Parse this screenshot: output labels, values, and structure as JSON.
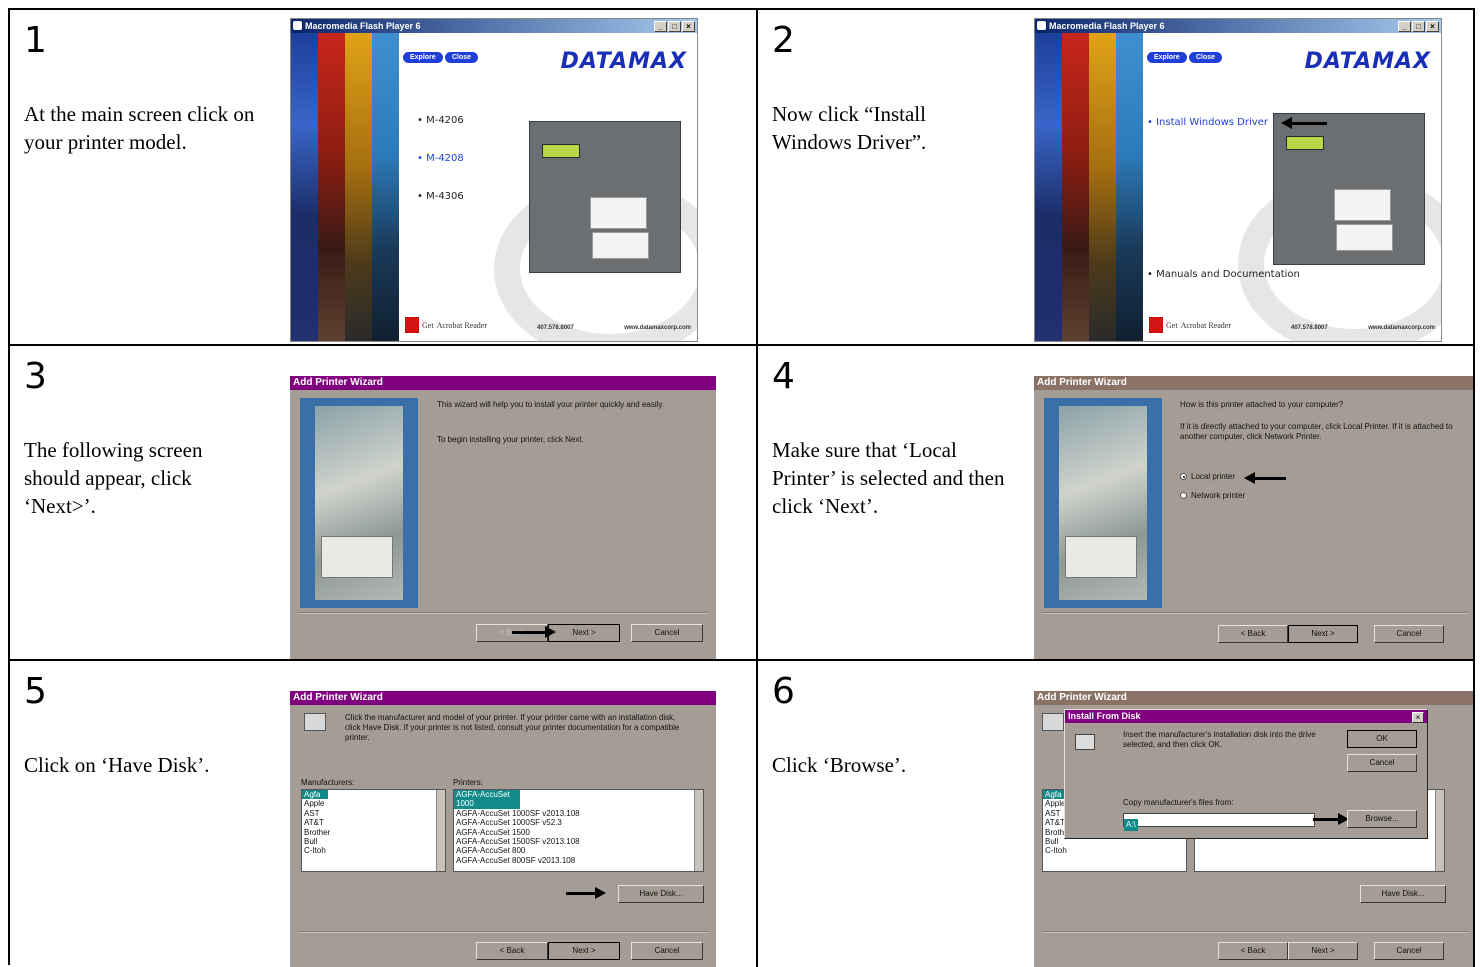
{
  "steps": [
    {
      "number": "1",
      "text": "At the main screen click on your printer model."
    },
    {
      "number": "2",
      "text": "Now click “Install Windows Driver”."
    },
    {
      "number": "3",
      "text": "The following screen should appear, click ‘Next>’."
    },
    {
      "number": "4",
      "text": "Make sure that ‘Local Printer’ is selected and then click ‘Next’."
    },
    {
      "number": "5",
      "text": "Click on ‘Have Disk’."
    },
    {
      "number": "6",
      "text": "Click ‘Browse’."
    }
  ],
  "flash": {
    "title": "Macromedia Flash Player 6",
    "win_buttons": [
      "_",
      "□",
      "×"
    ],
    "explore": "Explore",
    "close": "Close",
    "brand": "DATAMAX",
    "models": [
      "M-4206",
      "M-4208",
      "M-4306"
    ],
    "install_driver": "• Install Windows Driver",
    "manuals": "• Manuals and Documentation",
    "acrobat_get": "Get",
    "acrobat_name": "Acrobat Reader",
    "phone": "407.578.8007",
    "web": "www.datamaxcorp.com",
    "colors": {
      "strip1": "#1d3f9a",
      "strip2": "#c8261a",
      "strip3": "#e0a317",
      "strip4": "#2d7ab8",
      "brand": "#1a2fb8"
    }
  },
  "wizard": {
    "title": "Add Printer Wizard",
    "title_colors": {
      "active": "#800080",
      "inactive": "#8a7267"
    },
    "intro_1": "This wizard will help you to install your printer quickly and easily.",
    "intro_2": "To begin installing your printer, click Next.",
    "attach_question": "How is this printer attached to your computer?",
    "attach_help": "If it is directly attached to your computer, click Local Printer. If it is attached to another computer, click Network Printer.",
    "local": "Local printer",
    "network": "Network printer",
    "back": "< Back",
    "next": "Next >",
    "cancel": "Cancel",
    "mfr_help": "Click the manufacturer and model of your printer. If your printer came with an installation disk, click Have Disk. If your printer is not listed, consult your printer documentation for a compatible printer.",
    "manufacturers_label": "Manufacturers:",
    "printers_label": "Printers:",
    "manufacturers": [
      "Agfa",
      "Apple",
      "AST",
      "AT&T",
      "Brother",
      "Bull",
      "C-Itoh"
    ],
    "printers": [
      "AGFA-AccuSet 1000",
      "AGFA-AccuSet 1000SF v2013.108",
      "AGFA-AccuSet 1000SF v52.3",
      "AGFA-AccuSet 1500",
      "AGFA-AccuSet 1500SF v2013.108",
      "AGFA-AccuSet 800",
      "AGFA-AccuSet 800SF v2013.108"
    ],
    "have_disk": "Have Disk...",
    "install_from_disk": "Install From Disk",
    "insert_disk": "Insert the manufacturer's installation disk into the drive selected, and then click OK.",
    "ok": "OK",
    "copy_from": "Copy manufacturer's files from:",
    "path_value": "A:\\",
    "browse": "Browse..."
  }
}
